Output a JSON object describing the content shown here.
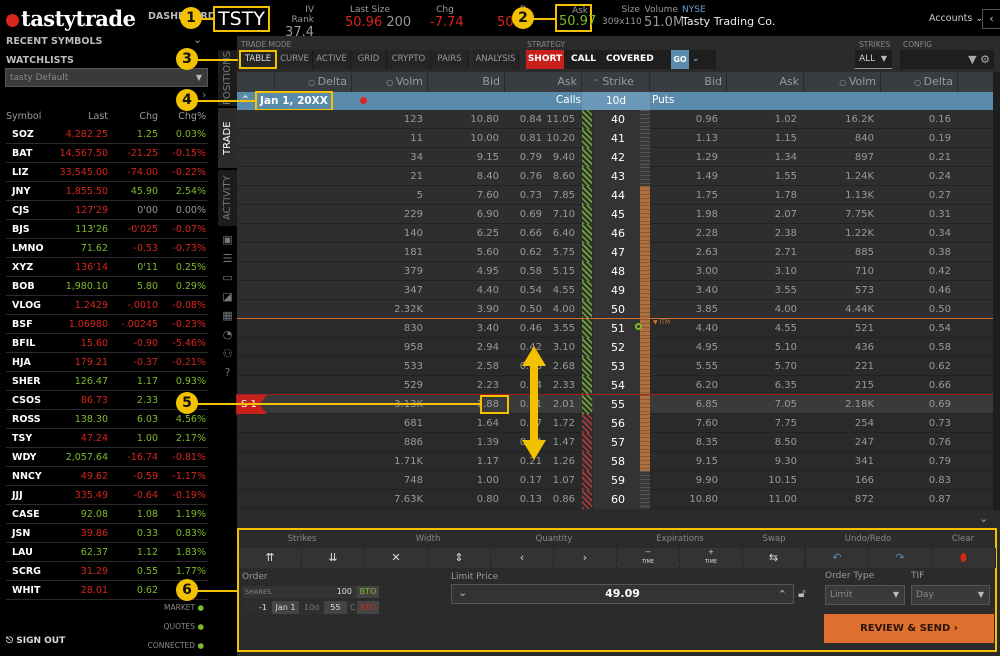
{
  "brand": "tastytrade",
  "top": {
    "dashboard": "DASHBOARD",
    "symbol": "TSTY",
    "iv_rank_label": "IV Rank",
    "iv_rank": "37.4",
    "last_size_label": "Last Size",
    "last": "50.96",
    "last_size": "200",
    "chg_label": "Chg",
    "chg": "-7.74",
    "bid_label": "B",
    "bid": "50.9",
    "ask_label": "Ask",
    "ask": "50.97",
    "size_label": "Size",
    "size": "309x110",
    "volume_label": "Volume",
    "volume": "51.0M",
    "exchange": "NYSE",
    "company": "Tasty Trading Co.",
    "accounts": "Accounts"
  },
  "sidebar": {
    "recent": "RECENT SYMBOLS",
    "watchlists": "WATCHLISTS",
    "watchlist_selected": "tasty Default",
    "columns": [
      "Symbol",
      "Last",
      "Chg",
      "Chg%"
    ],
    "rows": [
      [
        "SOZ",
        "4,282.25",
        "1.25",
        "0.03%",
        "r",
        "g"
      ],
      [
        "BAT",
        "14,567.50",
        "-21.25",
        "-0.15%",
        "r",
        "r"
      ],
      [
        "LIZ",
        "33,545.00",
        "-74.00",
        "-0.22%",
        "r",
        "r"
      ],
      [
        "JNY",
        "1,855.50",
        "45.90",
        "2.54%",
        "r",
        "g"
      ],
      [
        "CJS",
        "127'29",
        "0'00",
        "0.00%",
        "r",
        "n"
      ],
      [
        "BJS",
        "113'26",
        "-0'025",
        "-0.07%",
        "g",
        "r"
      ],
      [
        "LMNO",
        "71.62",
        "-0.53",
        "-0.73%",
        "g",
        "r"
      ],
      [
        "XYZ",
        "136'14",
        "0'11",
        "0.25%",
        "r",
        "g"
      ],
      [
        "BOB",
        "1,980.10",
        "5.80",
        "0.29%",
        "g",
        "g"
      ],
      [
        "VLOG",
        "1.2429",
        "-.0010",
        "-0.08%",
        "r",
        "r"
      ],
      [
        "BSF",
        "1.06980",
        "-.00245",
        "-0.23%",
        "r",
        "r"
      ],
      [
        "BFIL",
        "15.60",
        "-0.90",
        "-5.46%",
        "r",
        "r"
      ],
      [
        "HJA",
        "179.21",
        "-0.37",
        "-0.21%",
        "r",
        "r"
      ],
      [
        "SHER",
        "126.47",
        "1.17",
        "0.93%",
        "g",
        "g"
      ],
      [
        "CSOS",
        "86.73",
        "2.33",
        "",
        "r",
        "g"
      ],
      [
        "ROSS",
        "138.30",
        "6.03",
        "4.56%",
        "g",
        "g"
      ],
      [
        "TSY",
        "47.24",
        "1.00",
        "2.17%",
        "r",
        "g"
      ],
      [
        "WDY",
        "2,057.64",
        "-16.74",
        "-0.81%",
        "g",
        "r"
      ],
      [
        "NNCY",
        "49.62",
        "-0.59",
        "-1.17%",
        "r",
        "r"
      ],
      [
        "JJJ",
        "335.49",
        "-0.64",
        "-0.19%",
        "r",
        "r"
      ],
      [
        "CASE",
        "92.08",
        "1.08",
        "1.19%",
        "g",
        "g"
      ],
      [
        "JSN",
        "39.86",
        "0.33",
        "0.83%",
        "r",
        "g"
      ],
      [
        "LAU",
        "62.37",
        "1.12",
        "1.83%",
        "g",
        "g"
      ],
      [
        "SCRG",
        "31.29",
        "0.55",
        "1.77%",
        "r",
        "g"
      ],
      [
        "WHIT",
        "28.01",
        "0.62",
        "",
        "r",
        "g"
      ]
    ],
    "status": [
      "MARKET",
      "QUOTES",
      "CONNECTED"
    ],
    "sign_out": "SIGN OUT"
  },
  "vtabs": [
    "POSITIONS",
    "TRADE",
    "ACTIVITY"
  ],
  "trade_mode": {
    "label": "TRADE MODE",
    "modes": [
      "TABLE",
      "CURVE",
      "ACTIVE",
      "GRID",
      "CRYPTO",
      "PAIRS",
      "ANALYSIS"
    ],
    "active": "TABLE"
  },
  "strategy": {
    "label": "STRATEGY",
    "side": "SHORT",
    "type": "CALL",
    "name": "COVERED",
    "go": "GO"
  },
  "strikes": {
    "label": "STRIKES",
    "value": "ALL"
  },
  "config": {
    "label": "CONFIG"
  },
  "chain": {
    "headers": [
      "Delta",
      "Volm",
      "Bid",
      "Ask",
      "Strike",
      "Bid",
      "Ask",
      "Volm",
      "Delta"
    ],
    "expiration": "Jan 1, 20XX",
    "calls": "Calls",
    "dte": "10d",
    "puts": "Puts",
    "itm_label": "ITM",
    "position_tag": "S 1",
    "rows": [
      [
        "0.84",
        "123",
        "10.80",
        "11.05",
        "40",
        "0.96",
        "1.02",
        "16.2K",
        "0.16"
      ],
      [
        "0.81",
        "11",
        "10.00",
        "10.20",
        "41",
        "1.13",
        "1.15",
        "840",
        "0.19"
      ],
      [
        "0.79",
        "34",
        "9.15",
        "9.40",
        "42",
        "1.29",
        "1.34",
        "897",
        "0.21"
      ],
      [
        "0.76",
        "21",
        "8.40",
        "8.60",
        "43",
        "1.49",
        "1.55",
        "1.24K",
        "0.24"
      ],
      [
        "0.73",
        "5",
        "7.60",
        "7.85",
        "44",
        "1.75",
        "1.78",
        "1.13K",
        "0.27"
      ],
      [
        "0.69",
        "229",
        "6.90",
        "7.10",
        "45",
        "1.98",
        "2.07",
        "7.75K",
        "0.31"
      ],
      [
        "0.66",
        "140",
        "6.25",
        "6.40",
        "46",
        "2.28",
        "2.38",
        "1.22K",
        "0.34"
      ],
      [
        "0.62",
        "181",
        "5.60",
        "5.75",
        "47",
        "2.63",
        "2.71",
        "885",
        "0.38"
      ],
      [
        "0.58",
        "379",
        "4.95",
        "5.15",
        "48",
        "3.00",
        "3.10",
        "710",
        "0.42"
      ],
      [
        "0.54",
        "347",
        "4.40",
        "4.55",
        "49",
        "3.40",
        "3.55",
        "573",
        "0.46"
      ],
      [
        "0.50",
        "2.32K",
        "3.90",
        "4.00",
        "50",
        "3.85",
        "4.00",
        "4.44K",
        "0.50"
      ],
      [
        "0.46",
        "830",
        "3.40",
        "3.55",
        "51",
        "4.40",
        "4.55",
        "521",
        "0.54"
      ],
      [
        "0.42",
        "958",
        "2.94",
        "3.10",
        "52",
        "4.95",
        "5.10",
        "436",
        "0.58"
      ],
      [
        "0.38",
        "533",
        "2.58",
        "2.68",
        "53",
        "5.55",
        "5.70",
        "221",
        "0.62"
      ],
      [
        "0.34",
        "529",
        "2.23",
        "2.33",
        "54",
        "6.20",
        "6.35",
        "215",
        "0.66"
      ],
      [
        "0.31",
        "3.13K",
        "1.88",
        "2.01",
        "55",
        "6.85",
        "7.05",
        "2.18K",
        "0.69"
      ],
      [
        "0.27",
        "681",
        "1.64",
        "1.72",
        "56",
        "7.60",
        "7.75",
        "254",
        "0.73"
      ],
      [
        "0.24",
        "886",
        "1.39",
        "1.47",
        "57",
        "8.35",
        "8.50",
        "247",
        "0.76"
      ],
      [
        "0.21",
        "1.71K",
        "1.17",
        "1.26",
        "58",
        "9.15",
        "9.30",
        "341",
        "0.79"
      ],
      [
        "0.17",
        "748",
        "1.00",
        "1.07",
        "59",
        "9.90",
        "10.15",
        "166",
        "0.83"
      ],
      [
        "0.13",
        "7.63K",
        "0.80",
        "0.86",
        "60",
        "10.80",
        "11.00",
        "872",
        "0.87"
      ]
    ],
    "selected_strike": "55"
  },
  "order": {
    "groups": [
      "Strikes",
      "Width",
      "Quantity",
      "Expirations",
      "Swap",
      "Undo/Redo",
      "Clear"
    ],
    "label": "Order",
    "shares_label": "SHARES",
    "shares": "100",
    "shares_action": "BTO",
    "leg": {
      "qty": "-1",
      "exp": "Jan 1",
      "dte": "10d",
      "strike": "55",
      "type": "C",
      "action": "STO"
    },
    "limit_label": "Limit Price",
    "limit": "49.09",
    "order_type_label": "Order Type",
    "order_type": "Limit",
    "tif_label": "TIF",
    "tif": "Day",
    "submit": "REVIEW & SEND",
    "time_label": "TIME"
  },
  "callouts": [
    "1",
    "2",
    "3",
    "4",
    "5",
    "6"
  ],
  "colors": {
    "accent": "#f2c200",
    "red": "#d8261c",
    "green": "#7dbb2a",
    "expiry": "#5b8bab",
    "submit": "#e07030"
  }
}
